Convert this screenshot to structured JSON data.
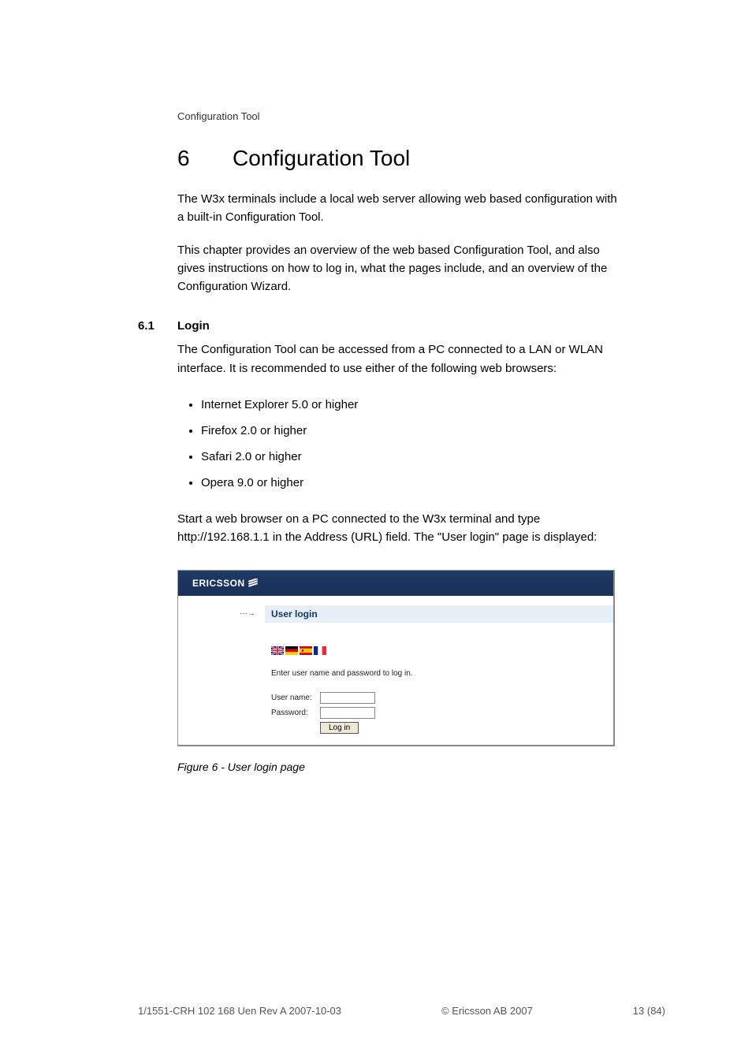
{
  "header": {
    "section": "Configuration Tool"
  },
  "chapter": {
    "number": "6",
    "title": "Configuration Tool"
  },
  "paragraphs": {
    "intro1": "The W3x terminals include a local web server allowing web based configuration with a built-in Configuration Tool.",
    "intro2": "This chapter provides an overview of the web based Configuration Tool, and also gives instructions on how to log in, what the pages include, and an overview of the Configuration Wizard.",
    "login1": "The Configuration Tool can be accessed from a PC connected to a LAN or WLAN interface. It is recommended to use either of the following web browsers:",
    "login2": "Start a web browser on a PC connected to the W3x terminal and type http://192.168.1.1 in the Address (URL) field. The \"User login\" page is displayed:"
  },
  "section": {
    "number": "6.1",
    "title": "Login"
  },
  "browsers": [
    "Internet Explorer 5.0 or higher",
    "Firefox 2.0 or higher",
    "Safari 2.0 or higher",
    "Opera 9.0 or higher"
  ],
  "screenshot": {
    "logo": "ERICSSON",
    "arrow": "···→",
    "title": "User login",
    "instruction": "Enter user name and password to log in.",
    "username_label": "User name:",
    "password_label": "Password:",
    "login_button": "Log in",
    "flags": {
      "uk": "flag-uk",
      "de": "flag-de",
      "es": "flag-es",
      "fr": "flag-fr"
    }
  },
  "figure_caption": "Figure 6 - User login page",
  "footer": {
    "doc_ref": "1/1551-CRH 102 168 Uen Rev A 2007-10-03",
    "copyright": "© Ericsson AB 2007",
    "page": "13 (84)"
  }
}
